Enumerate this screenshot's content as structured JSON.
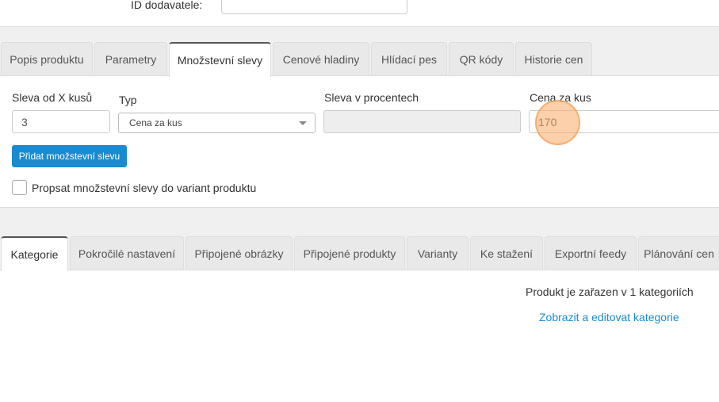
{
  "top": {
    "supplier_id_label": "ID dodavatele:",
    "supplier_id_value": ""
  },
  "tabs1": [
    "Popis produktu",
    "Parametry",
    "Množstevní slevy",
    "Cenové hladiny",
    "Hlídací pes",
    "QR kódy",
    "Historie cen"
  ],
  "discount": {
    "qty_label": "Sleva od X kusů",
    "qty_value": "3",
    "type_label": "Typ",
    "type_value": "Cena za kus",
    "percent_label": "Sleva v procentech",
    "percent_value": "",
    "price_label": "Cena za kus",
    "price_value": "170",
    "add_button": "Přidat množstevní slevu",
    "propagate_label": "Propsat množstevní slevy do variant produktu"
  },
  "tabs2": [
    "Kategorie",
    "Pokročilé nastavení",
    "Připojené obrázky",
    "Připojené produkty",
    "Varianty",
    "Ke stažení",
    "Exportní feedy",
    "Plánování cen"
  ],
  "categories": {
    "count_text": "Produkt je zařazen v 1 kategoriích",
    "edit_link": "Zobrazit a editovat kategorie"
  },
  "colors": {
    "accent": "#1a8bd0",
    "highlight": "#f5a05a"
  }
}
